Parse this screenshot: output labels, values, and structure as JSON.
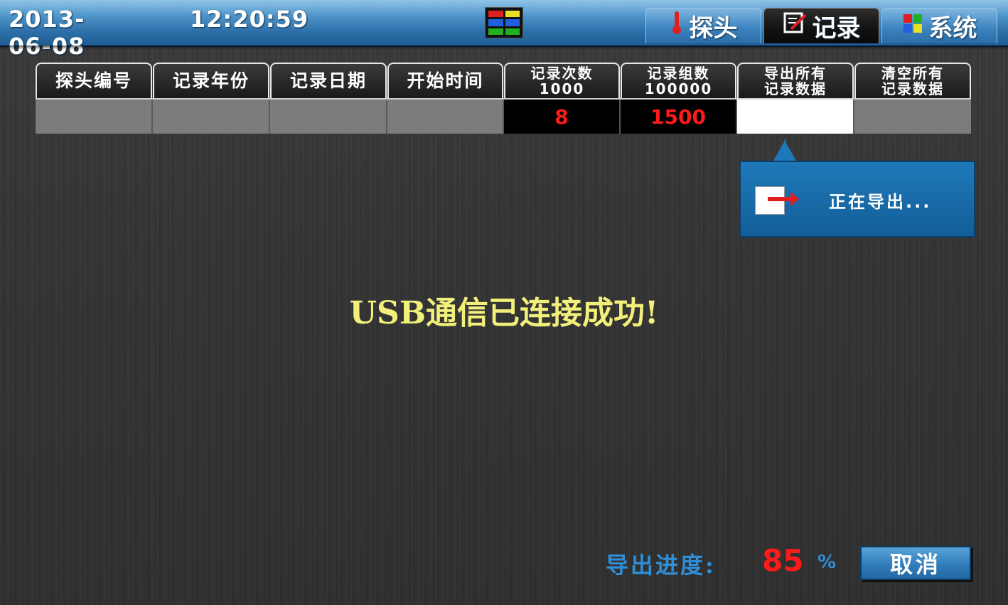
{
  "header": {
    "date": "2013-06-08",
    "time": "12:20:59",
    "tabs": [
      {
        "label": "探头",
        "icon": "thermometer-icon",
        "active": false
      },
      {
        "label": "记录",
        "icon": "record-icon",
        "active": true
      },
      {
        "label": "系统",
        "icon": "system-grid-icon",
        "active": false
      }
    ]
  },
  "table": {
    "headers": {
      "probe_no": "探头编号",
      "record_year": "记录年份",
      "record_date": "记录日期",
      "start_time": "开始时间",
      "record_count_line1": "记录次数",
      "record_count_line2": "1000",
      "record_groups_line1": "记录组数",
      "record_groups_line2": "100000",
      "export_line1": "导出所有",
      "export_line2": "记录数据",
      "clear_line1": "清空所有",
      "clear_line2": "记录数据"
    },
    "values": {
      "record_count": "8",
      "record_groups": "1500"
    }
  },
  "popup": {
    "text": "正在导出...",
    "icon": "export-icon"
  },
  "message": "USB通信已连接成功!",
  "progress": {
    "label": "导出进度:",
    "value": "85",
    "unit": "%",
    "percent": 85
  },
  "cancel_label": "取消",
  "colors": {
    "accent_blue": "#2f8fd6",
    "value_red": "#ff1a1a",
    "message_yellow": "#f2f07a"
  }
}
